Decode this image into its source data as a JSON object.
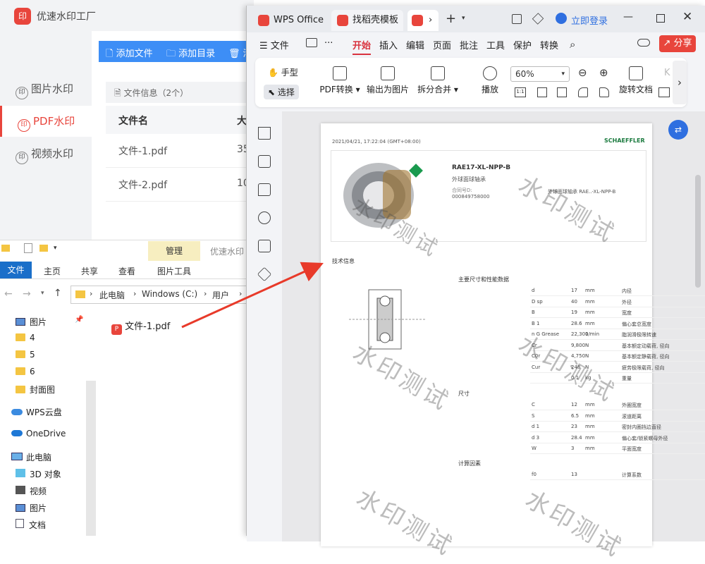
{
  "bg_app": {
    "title": "优速水印工厂",
    "nav": [
      {
        "label": "图片水印",
        "active": false
      },
      {
        "label": "PDF水印",
        "active": true
      },
      {
        "label": "视频水印",
        "active": false
      }
    ],
    "toolbar": {
      "add_file": "添加文件",
      "add_dir": "添加目录",
      "clear": "清"
    },
    "file_info": "文件信息（2个）",
    "col_name": "文件名",
    "col_size": "大",
    "rows": [
      {
        "name": "文件-1.pdf",
        "size": "35"
      },
      {
        "name": "文件-2.pdf",
        "size": "10"
      }
    ]
  },
  "explorer": {
    "manage_tab": "管理",
    "window_title": "优速水印",
    "ribbon_tabs": [
      "文件",
      "主页",
      "共享",
      "查看",
      "图片工具"
    ],
    "path": [
      "此电脑",
      "Windows (C:)",
      "用户"
    ],
    "tree": [
      {
        "label": "图片",
        "icon": "pictures-icon"
      },
      {
        "label": "4",
        "icon": "folder-icon"
      },
      {
        "label": "5",
        "icon": "folder-icon"
      },
      {
        "label": "6",
        "icon": "folder-icon"
      },
      {
        "label": "封面图",
        "icon": "folder-icon"
      },
      {
        "label": "WPS云盘",
        "icon": "cloud-icon"
      },
      {
        "label": "OneDrive",
        "icon": "cloud-icon"
      },
      {
        "label": "此电脑",
        "icon": "computer-icon"
      },
      {
        "label": "3D 对象",
        "icon": "cube-icon"
      },
      {
        "label": "视频",
        "icon": "video-icon"
      },
      {
        "label": "图片",
        "icon": "pictures-icon"
      },
      {
        "label": "文档",
        "icon": "document-icon"
      }
    ],
    "file_item": "文件-1.pdf"
  },
  "wps": {
    "tabs": [
      {
        "label": "WPS Office",
        "color": "#e8453c"
      },
      {
        "label": "找稻壳模板",
        "color": "#e8453c"
      }
    ],
    "login": "立即登录",
    "menu": [
      "文件",
      "开始",
      "插入",
      "编辑",
      "页面",
      "批注",
      "工具",
      "保护",
      "转换"
    ],
    "active_menu": "开始",
    "share": "分享",
    "ribbon": {
      "hand": "手型",
      "select": "选择",
      "pdf_convert": "PDF转换",
      "export_image": "输出为图片",
      "split_merge": "拆分合并",
      "play": "播放",
      "zoom": "60%",
      "rotate": "旋转文档"
    },
    "page": {
      "timestamp": "2021/04/21, 17:22:04 (GMT+08:00)",
      "brand": "SCHAEFFLER",
      "product": "RAE17-XL-NPP-B",
      "product_desc": "外球面球轴承",
      "order_label": "合同号D:",
      "order_no": "000849758000",
      "ref": "外球面球轴承 RAE..-XL-NPP-B",
      "section_tech": "技术信息",
      "section_main": "主要尺寸和性能数据",
      "section_dims": "尺寸",
      "section_calc": "计算因素",
      "main_rows": [
        {
          "sym": "d",
          "val": "17",
          "unit": "mm",
          "desc": "内径"
        },
        {
          "sym": "D sp",
          "val": "40",
          "unit": "mm",
          "desc": "外径"
        },
        {
          "sym": "B",
          "val": "19",
          "unit": "mm",
          "desc": "宽度"
        },
        {
          "sym": "B 1",
          "val": "28.6",
          "unit": "mm",
          "desc": "偏心套总宽度"
        },
        {
          "sym": "n G Grease",
          "val": "22,300",
          "unit": "1/min",
          "desc": "脂润滑极限转速"
        },
        {
          "sym": "Cr",
          "val": "9,800",
          "unit": "N",
          "desc": "基本额定动载荷, 径向"
        },
        {
          "sym": "C0r",
          "val": "4,750",
          "unit": "N",
          "desc": "基本额定静载荷, 径向"
        },
        {
          "sym": "Cur",
          "val": "248",
          "unit": "N",
          "desc": "疲劳极限载荷, 径向"
        },
        {
          "sym": "",
          "val": "0.1",
          "unit": "kg",
          "desc": "重量"
        }
      ],
      "dim_rows": [
        {
          "sym": "C",
          "val": "12",
          "unit": "mm",
          "desc": "外圈宽度"
        },
        {
          "sym": "S",
          "val": "6.5",
          "unit": "mm",
          "desc": "滚道距离"
        },
        {
          "sym": "d 1",
          "val": "23",
          "unit": "mm",
          "desc": "密封内圈挡边直径"
        },
        {
          "sym": "d 3",
          "val": "28.4",
          "unit": "mm",
          "desc": "偏心套/锁紧螺母外径"
        },
        {
          "sym": "W",
          "val": "3",
          "unit": "mm",
          "desc": "平面宽度"
        }
      ],
      "calc_rows": [
        {
          "sym": "f0",
          "val": "13",
          "unit": "",
          "desc": "计算系数"
        }
      ],
      "watermark": "水印测试"
    }
  }
}
